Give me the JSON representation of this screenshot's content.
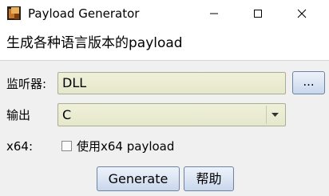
{
  "window": {
    "title": "Payload Generator",
    "minimize_icon": "minimize-icon",
    "maximize_icon": "maximize-icon",
    "close_icon": "close-icon"
  },
  "header": {
    "text": "生成各种语言版本的payload"
  },
  "form": {
    "listener_label": "监听器:",
    "listener_value": "DLL",
    "browse_label": "...",
    "output_label": "输出",
    "output_value": "C",
    "x64_label": "x64:",
    "x64_checkbox_label": "使用x64 payload",
    "x64_checked": false
  },
  "buttons": {
    "generate": "Generate",
    "help": "帮助"
  },
  "colors": {
    "field_bg": "#eff0d9",
    "button_bg": "#dbe5f4",
    "panel_bg": "#f0f0f0"
  }
}
